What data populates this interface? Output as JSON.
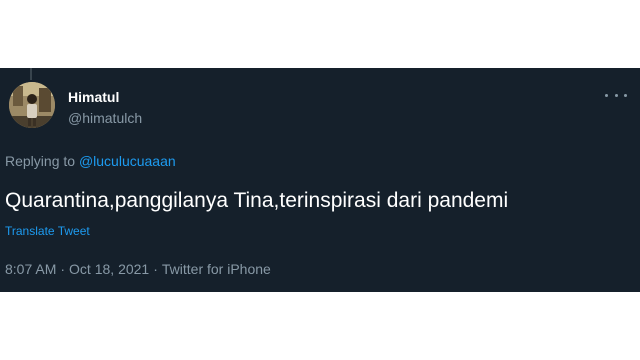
{
  "tweet": {
    "display_name": "Himatul",
    "username": "@himatulch",
    "replying_prefix": "Replying to",
    "replying_to": "@luculucuaaan",
    "text": "Quarantina,panggilanya Tina,terinspirasi dari pandemi",
    "translate_label": "Translate Tweet",
    "time": "8:07 AM",
    "date": "Oct 18, 2021",
    "source": "Twitter for iPhone",
    "separator": "·",
    "avatar_icon": "user-avatar",
    "more_icon": "more-horizontal-icon"
  },
  "colors": {
    "background": "#15202b",
    "text_primary": "#ffffff",
    "text_secondary": "#8899a6",
    "link": "#1d9bf0"
  }
}
